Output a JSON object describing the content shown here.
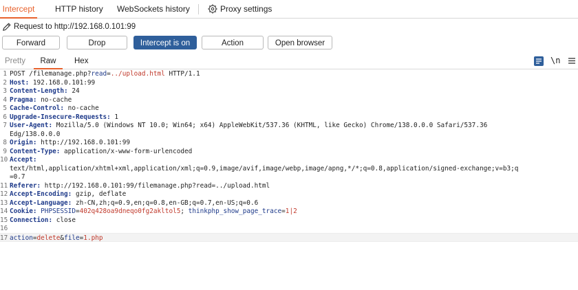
{
  "tabs": [
    {
      "label": "Intercept"
    },
    {
      "label": "HTTP history"
    },
    {
      "label": "WebSockets history"
    },
    {
      "label": "Proxy settings"
    }
  ],
  "request_line": "Request to http://192.168.0.101:99",
  "buttons": {
    "forward": "Forward",
    "drop": "Drop",
    "intercept": "Intercept is on",
    "action": "Action",
    "open_browser": "Open browser"
  },
  "view_tabs": {
    "pretty": "Pretty",
    "raw": "Raw",
    "hex": "Hex"
  },
  "newline_toggle": "\\n",
  "colors": {
    "accent": "#e8612c",
    "primary": "#2f5f9b",
    "header_key": "#1e3a8a",
    "param_value": "#c0392b"
  },
  "request": {
    "l1": {
      "n": "1",
      "method": "POST /filemanage.php?",
      "qk": "read",
      "eq": "=",
      "qv": "../upload.html",
      "rest": " HTTP/1.1"
    },
    "l2": {
      "n": "2",
      "key": "Host:",
      "val": " 192.168.0.101:99"
    },
    "l3": {
      "n": "3",
      "key": "Content-Length:",
      "val": " 24"
    },
    "l4": {
      "n": "4",
      "key": "Pragma:",
      "val": " no-cache"
    },
    "l5": {
      "n": "5",
      "key": "Cache-Control:",
      "val": " no-cache"
    },
    "l6": {
      "n": "6",
      "key": "Upgrade-Insecure-Requests:",
      "val": " 1"
    },
    "l7": {
      "n": "7",
      "key": "User-Agent:",
      "val": " Mozilla/5.0 (Windows NT 10.0; Win64; x64) AppleWebKit/537.36 (KHTML, like Gecko) Chrome/138.0.0.0 Safari/537.36",
      "wrap": "Edg/138.0.0.0"
    },
    "l8": {
      "n": "8",
      "key": "Origin:",
      "val": " http://192.168.0.101:99"
    },
    "l9": {
      "n": "9",
      "key": "Content-Type:",
      "val": " application/x-www-form-urlencoded"
    },
    "l10": {
      "n": "10",
      "key": "Accept:",
      "wrap1": "text/html,application/xhtml+xml,application/xml;q=0.9,image/avif,image/webp,image/apng,*/*;q=0.8,application/signed-exchange;v=b3;q",
      "wrap2": "=0.7"
    },
    "l11": {
      "n": "11",
      "key": "Referer:",
      "val": " http://192.168.0.101:99/filemanage.php?read=../upload.html"
    },
    "l12": {
      "n": "12",
      "key": "Accept-Encoding:",
      "val": " gzip, deflate"
    },
    "l13": {
      "n": "13",
      "key": "Accept-Language:",
      "val": " zh-CN,zh;q=0.9,en;q=0.8,en-GB;q=0.7,en-US;q=0.6"
    },
    "l14": {
      "n": "14",
      "key": "Cookie:",
      "c1k": " PHPSESSID",
      "c1e": "=",
      "c1v": "402q428oa9dneqo0fg2akltol5",
      "sep": "; ",
      "c2k": "thinkphp_show_page_trace",
      "c2e": "=",
      "c2v": "1|2"
    },
    "l15": {
      "n": "15",
      "key": "Connection:",
      "val": " close"
    },
    "l16": {
      "n": "16"
    },
    "l17": {
      "n": "17",
      "b1k": "action",
      "b1e": "=",
      "b1v": "delete",
      "amp": "&",
      "b2k": "file",
      "b2e": "=",
      "b2v": "1.php"
    }
  }
}
